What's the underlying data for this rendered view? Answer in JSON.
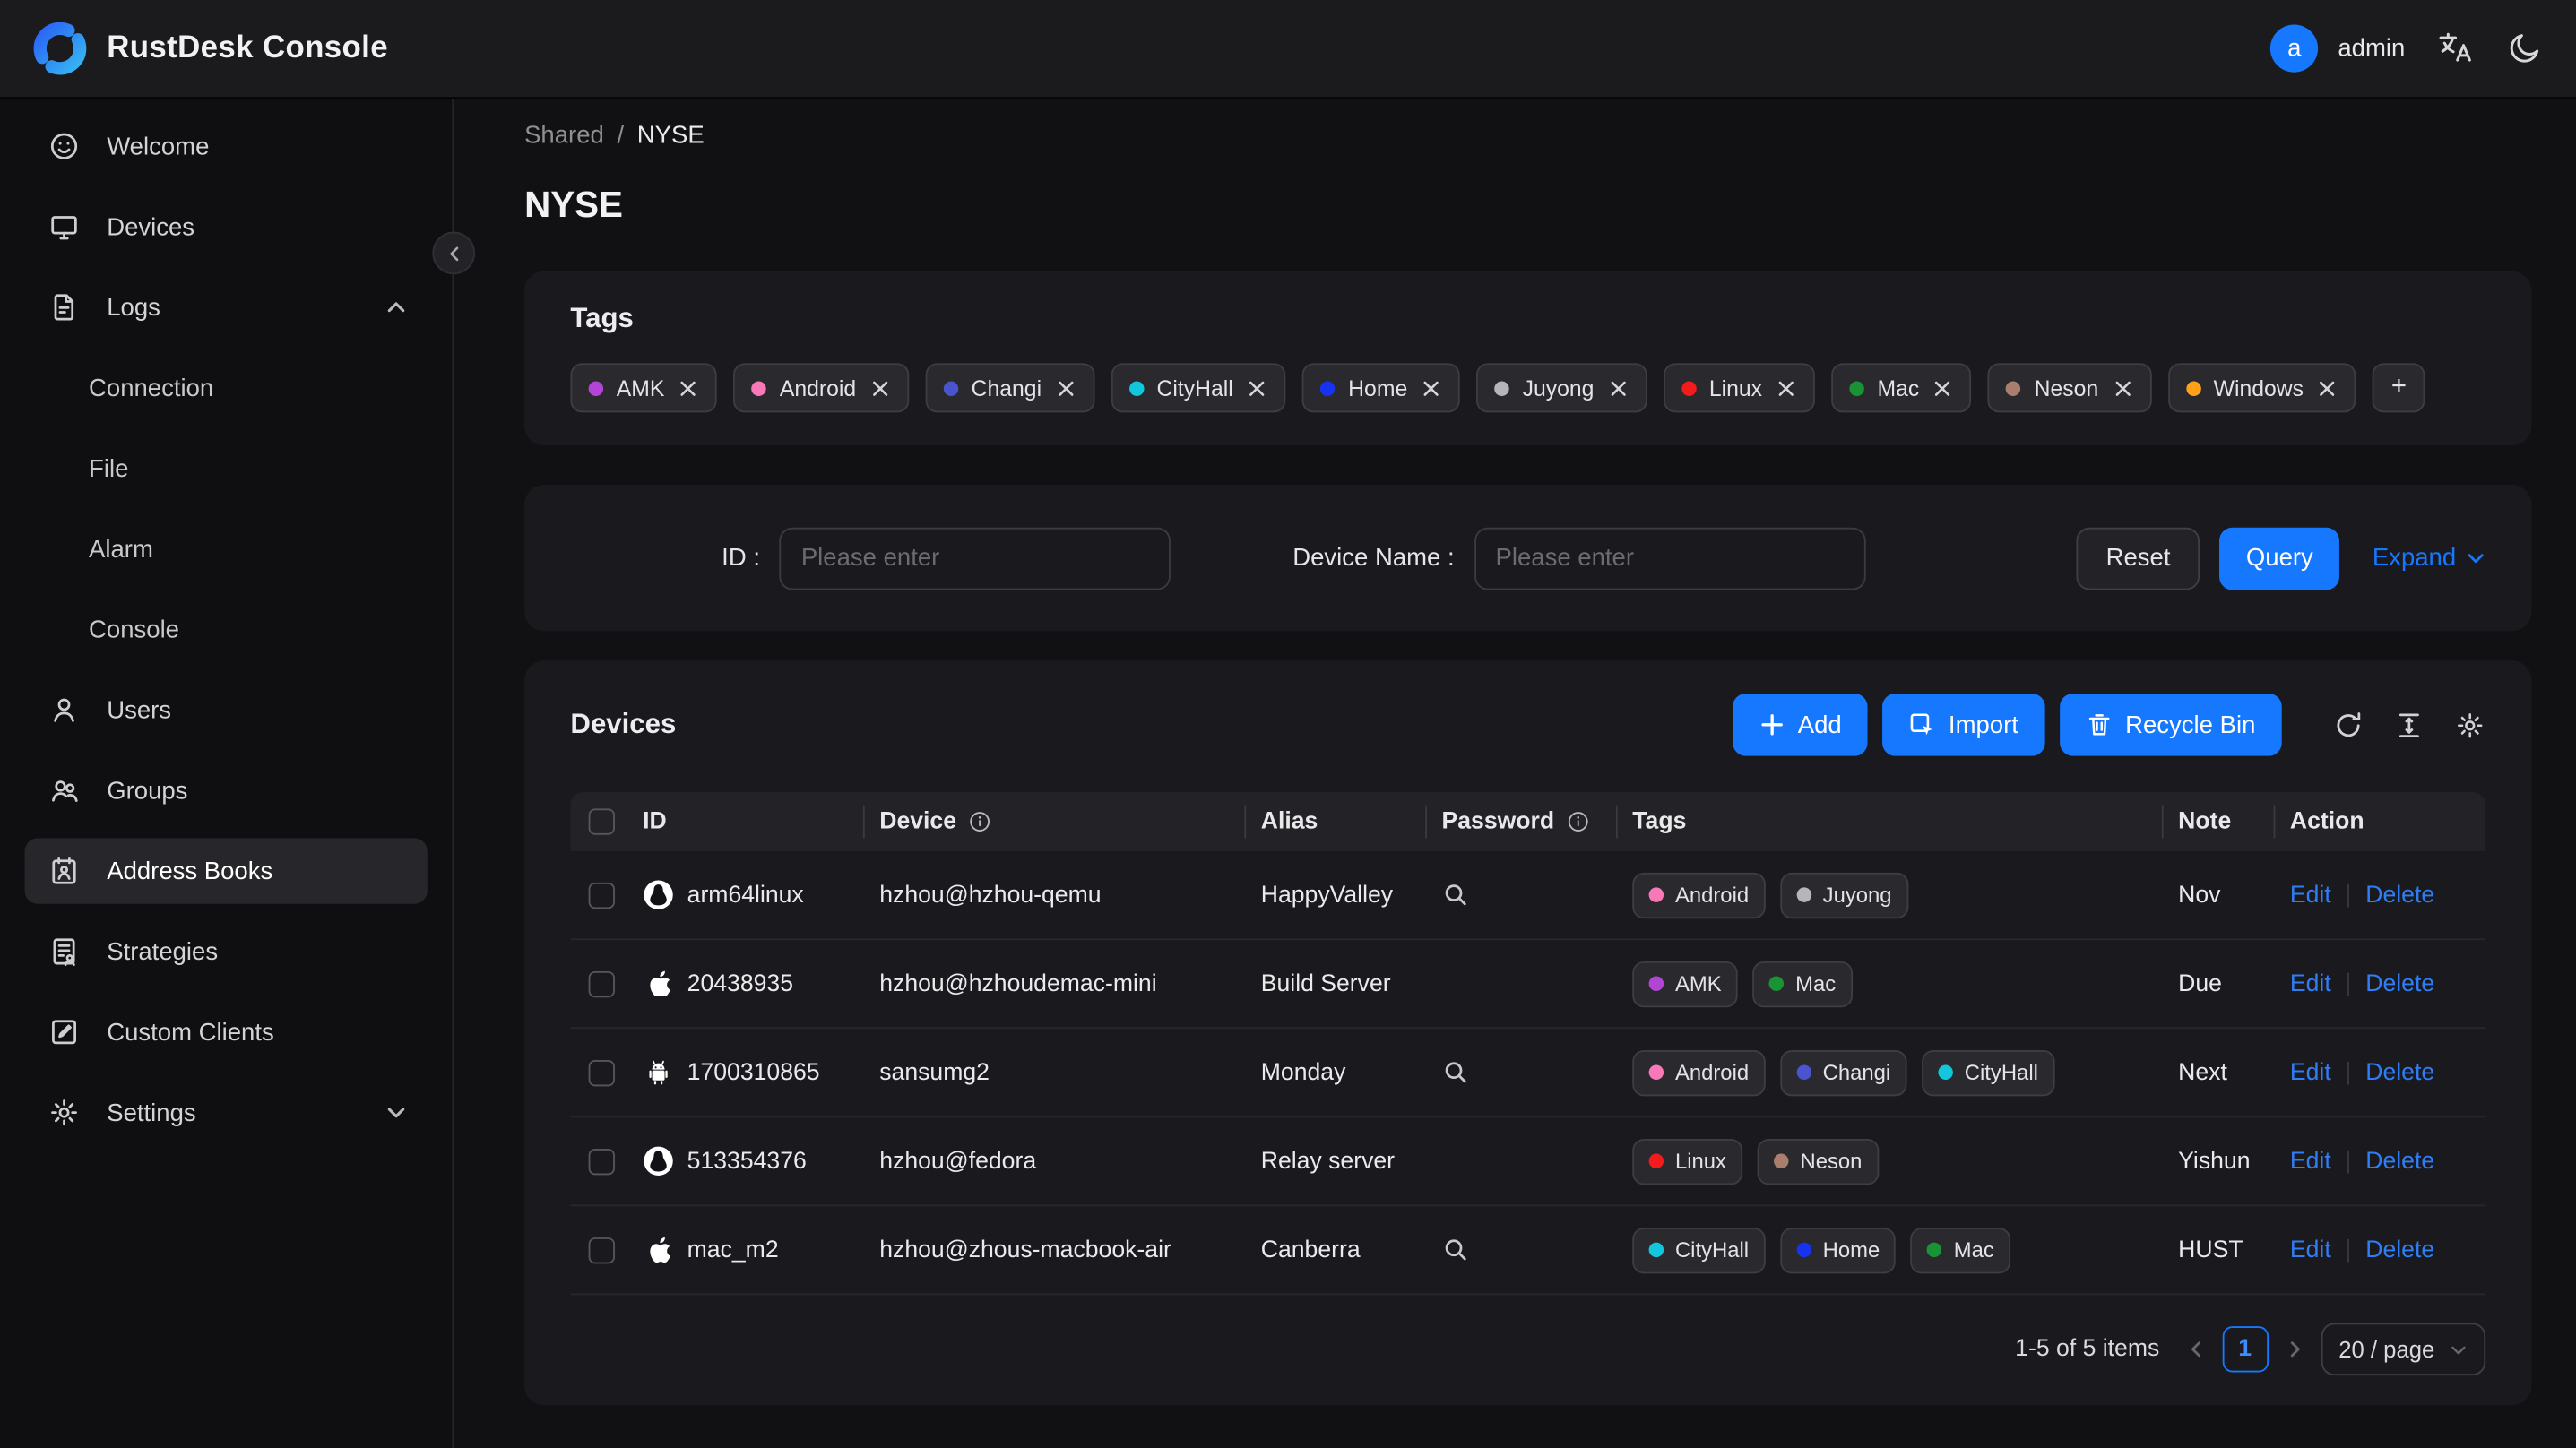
{
  "header": {
    "app_title": "RustDesk Console",
    "user": {
      "avatar_letter": "a",
      "name": "admin"
    },
    "icons": [
      "translate-icon",
      "moon-icon"
    ]
  },
  "sidebar": {
    "items": [
      {
        "label": "Welcome",
        "icon": "smiley-icon"
      },
      {
        "label": "Devices",
        "icon": "monitor-icon"
      },
      {
        "label": "Logs",
        "icon": "logs-icon",
        "chevron": "up",
        "children": [
          {
            "label": "Connection"
          },
          {
            "label": "File"
          },
          {
            "label": "Alarm"
          },
          {
            "label": "Console"
          }
        ]
      },
      {
        "label": "Users",
        "icon": "user-icon"
      },
      {
        "label": "Groups",
        "icon": "group-icon"
      },
      {
        "label": "Address Books",
        "icon": "address-book-icon",
        "active": true
      },
      {
        "label": "Strategies",
        "icon": "strategies-icon"
      },
      {
        "label": "Custom Clients",
        "icon": "custom-clients-icon"
      },
      {
        "label": "Settings",
        "icon": "gear-icon",
        "chevron": "down"
      }
    ]
  },
  "breadcrumb": {
    "parent": "Shared",
    "separator": "/",
    "current": "NYSE"
  },
  "page_title": "NYSE",
  "tags_card": {
    "title": "Tags",
    "add_label": "+",
    "tags": [
      {
        "name": "AMK",
        "color": "#b244d6"
      },
      {
        "name": "Android",
        "color": "#f878b8"
      },
      {
        "name": "Changi",
        "color": "#4a55cd"
      },
      {
        "name": "CityHall",
        "color": "#12c7dc"
      },
      {
        "name": "Home",
        "color": "#1733f2"
      },
      {
        "name": "Juyong",
        "color": "#b6b6ba"
      },
      {
        "name": "Linux",
        "color": "#f31b1b"
      },
      {
        "name": "Mac",
        "color": "#1a9334"
      },
      {
        "name": "Neson",
        "color": "#a97e6d"
      },
      {
        "name": "Windows",
        "color": "#ffa21a"
      }
    ]
  },
  "filter": {
    "id_label": "ID :",
    "id_placeholder": "Please enter",
    "device_name_label": "Device Name :",
    "device_name_placeholder": "Please enter",
    "reset_label": "Reset",
    "query_label": "Query",
    "expand_label": "Expand"
  },
  "devices_card": {
    "title": "Devices",
    "add_label": "Add",
    "import_label": "Import",
    "recycle_bin_label": "Recycle Bin",
    "toolbar_icons": [
      "refresh-icon",
      "column-height-icon",
      "settings-icon"
    ],
    "table": {
      "columns": [
        "ID",
        "Device",
        "Alias",
        "Password",
        "Tags",
        "Note",
        "Action"
      ],
      "edit_label": "Edit",
      "delete_label": "Delete",
      "rows": [
        {
          "os": "linux-icon",
          "id": "arm64linux",
          "device": "hzhou@hzhou-qemu",
          "alias": "HappyValley",
          "has_password": true,
          "tags": [
            "Android",
            "Juyong"
          ],
          "note": "Nov"
        },
        {
          "os": "apple-icon",
          "id": "20438935",
          "device": "hzhou@hzhoudemac-mini",
          "alias": "Build Server",
          "has_password": false,
          "tags": [
            "AMK",
            "Mac"
          ],
          "note": "Due"
        },
        {
          "os": "android-icon",
          "id": "1700310865",
          "device": "sansumg2",
          "alias": "Monday",
          "has_password": true,
          "tags": [
            "Android",
            "Changi",
            "CityHall"
          ],
          "note": "Next"
        },
        {
          "os": "linux-icon",
          "id": "513354376",
          "device": "hzhou@fedora",
          "alias": "Relay server",
          "has_password": false,
          "tags": [
            "Linux",
            "Neson"
          ],
          "note": "Yishun"
        },
        {
          "os": "apple-icon",
          "id": "mac_m2",
          "device": "hzhou@zhous-macbook-air",
          "alias": "Canberra",
          "has_password": true,
          "tags": [
            "CityHall",
            "Home",
            "Mac"
          ],
          "note": "HUST"
        }
      ]
    },
    "pagination": {
      "summary": "1-5 of 5 items",
      "current_page": "1",
      "page_size": "20 / page"
    }
  }
}
